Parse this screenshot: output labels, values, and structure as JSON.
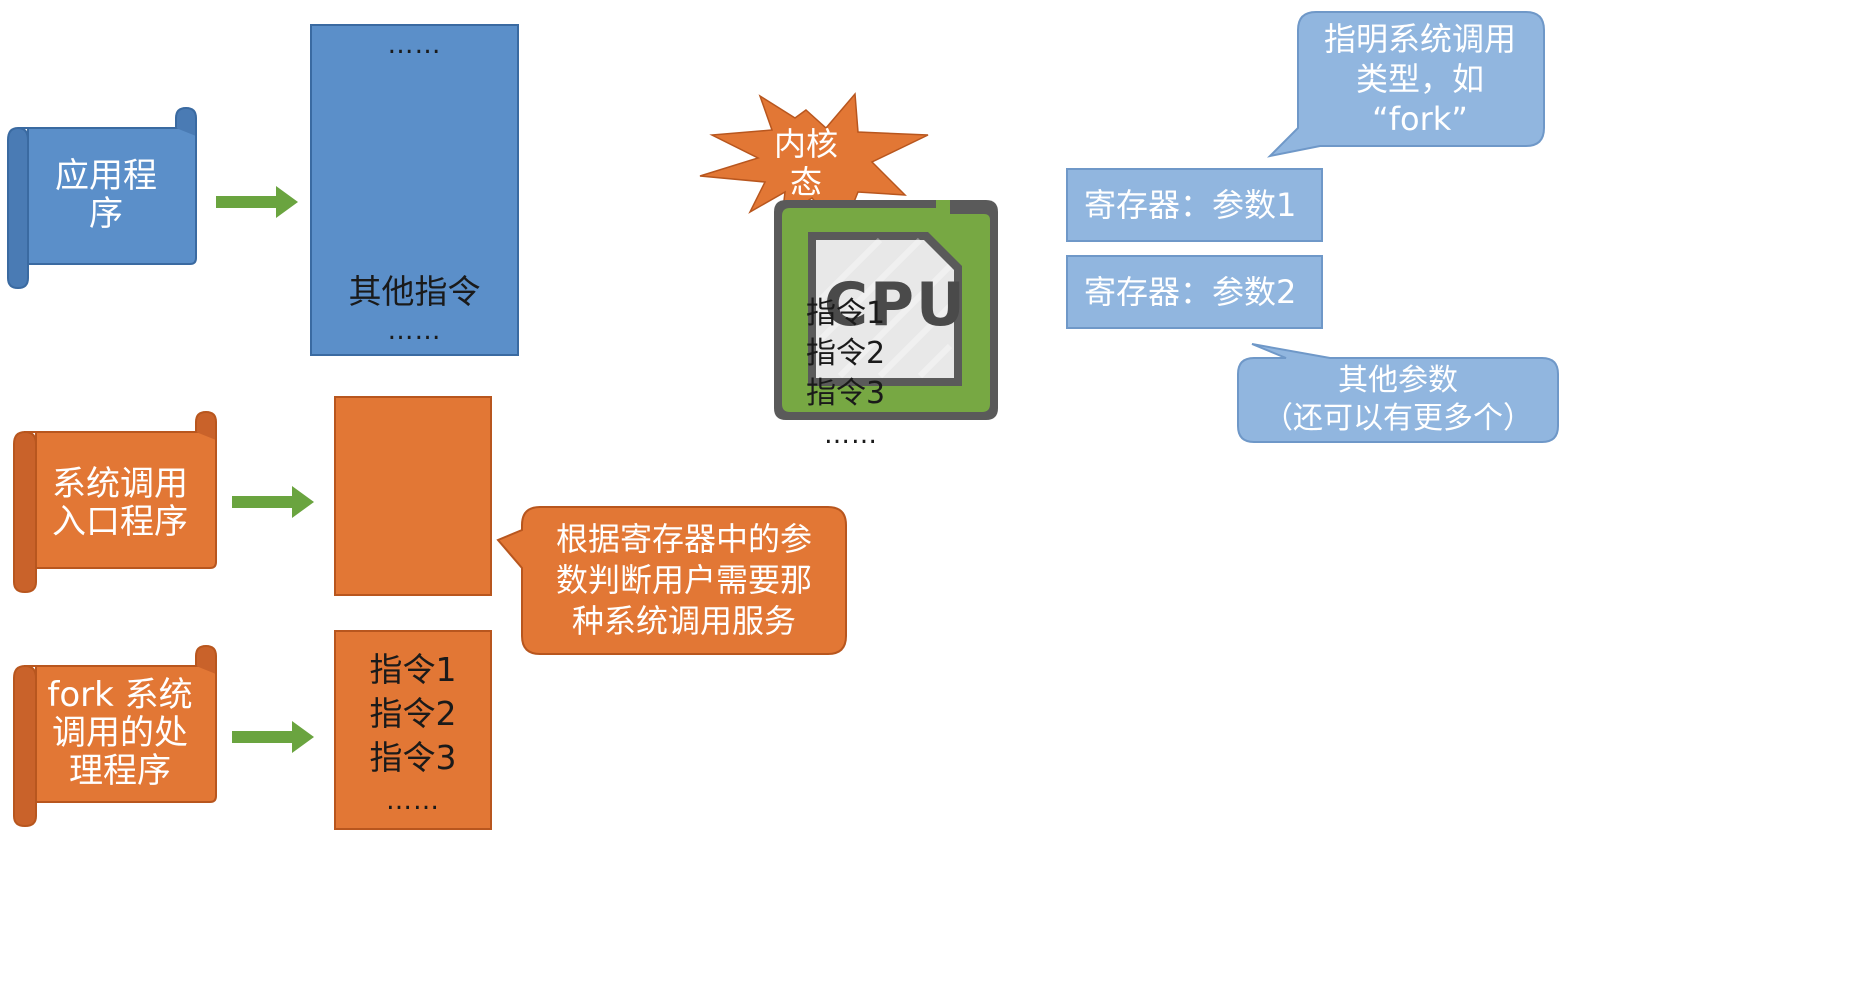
{
  "rows": {
    "app": {
      "label": "应用程\n序",
      "box_top_dots": "……",
      "box_instruction": "其他指令",
      "box_bottom_dots": "……"
    },
    "syscall_entry": {
      "label": "系统调用\n入口程序"
    },
    "fork_handler": {
      "label": "fork 系统\n调用的处\n理程序",
      "instructions": [
        "指令1",
        "指令2",
        "指令3"
      ],
      "dots": "……"
    }
  },
  "entry_callout": "根据寄存器中的参\n数判断用户需要那\n种系统调用服务",
  "cpu": {
    "chip_label": "CPU",
    "kernel_state": "内核\n态",
    "instructions": [
      "指令1",
      "指令2",
      "指令3"
    ],
    "dots": "……"
  },
  "syscall_type_callout": "指明系统调用\n类型，如\n“fork”",
  "registers": [
    "寄存器：参数1",
    "寄存器：参数2"
  ],
  "other_params_callout": "其他参数\n（还可以有更多个）",
  "colors": {
    "blue": "#5b8fc9",
    "orange": "#e27735",
    "green_arrow": "#6aa43f",
    "light_blue": "#91b6df",
    "chip_green": "#77a843"
  }
}
